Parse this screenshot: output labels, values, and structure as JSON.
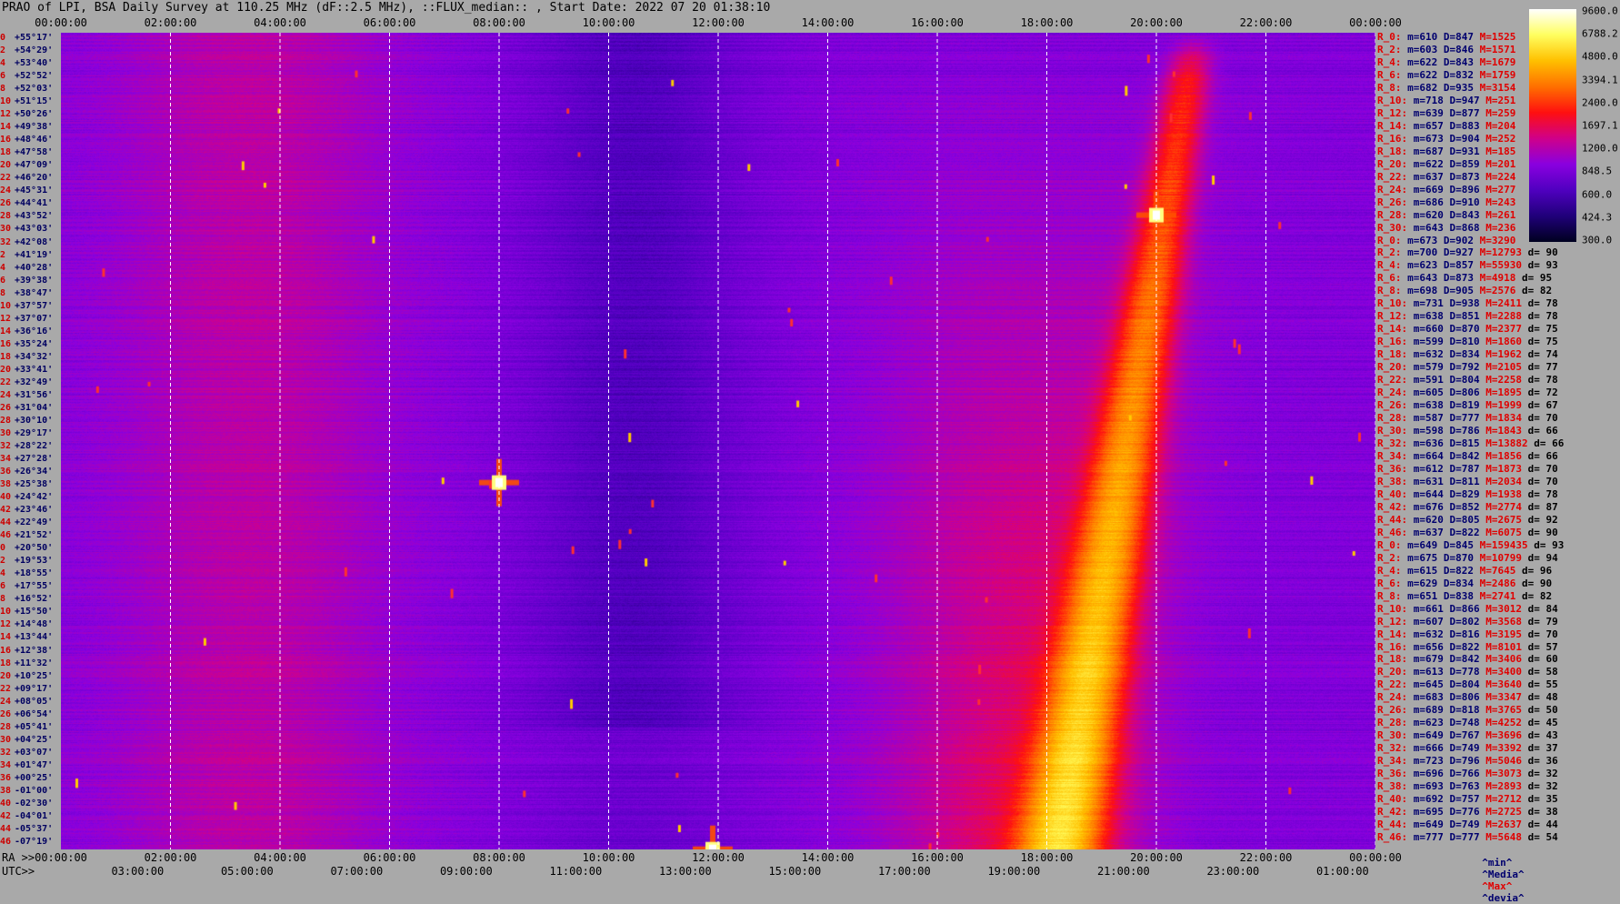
{
  "title": "PRAO of LPI, BSA Daily Survey at 110.25 MHz (dF::2.5 MHz), ::FLUX_median:: , Start Date: 2022 07 20 01:38:10",
  "top_axis": {
    "labels": [
      "00:00:00",
      "02:00:00",
      "04:00:00",
      "06:00:00",
      "08:00:00",
      "10:00:00",
      "12:00:00",
      "14:00:00",
      "16:00:00",
      "18:00:00",
      "20:00:00",
      "22:00:00",
      "00:00:00"
    ]
  },
  "bottom_axis": {
    "ra_prefix": "RA >>",
    "ra_labels": [
      "00:00:00",
      "02:00:00",
      "04:00:00",
      "06:00:00",
      "08:00:00",
      "10:00:00",
      "12:00:00",
      "14:00:00",
      "16:00:00",
      "18:00:00",
      "20:00:00",
      "22:00:00",
      "00:00:00"
    ],
    "utc_prefix": "UTC>>",
    "utc_labels": [
      "03:00:00",
      "05:00:00",
      "07:00:00",
      "09:00:00",
      "11:00:00",
      "13:00:00",
      "15:00:00",
      "17:00:00",
      "19:00:00",
      "21:00:00",
      "23:00:00",
      "01:00:00"
    ]
  },
  "colorbar": {
    "ticks": [
      "9600.0",
      "6788.2",
      "4800.0",
      "3394.1",
      "2400.0",
      "1697.1",
      "1200.0",
      "848.5",
      "600.0",
      "424.3",
      "300.0"
    ],
    "colors": [
      "#ffffff",
      "#ffff60",
      "#ffc000",
      "#ff7000",
      "#ff1010",
      "#d0008a",
      "#8a00e0",
      "#5000c0",
      "#20007a",
      "#000020"
    ]
  },
  "stats_footer": {
    "min": "^min^",
    "media": "^Media^",
    "max": "^Max^",
    "devia": "^devia^"
  },
  "declinations": [
    {
      "idx": "0",
      "dec": "+55°17'"
    },
    {
      "idx": "2",
      "dec": "+54°29'"
    },
    {
      "idx": "4",
      "dec": "+53°40'"
    },
    {
      "idx": "6",
      "dec": "+52°52'"
    },
    {
      "idx": "8",
      "dec": "+52°03'"
    },
    {
      "idx": "10",
      "dec": "+51°15'"
    },
    {
      "idx": "12",
      "dec": "+50°26'"
    },
    {
      "idx": "14",
      "dec": "+49°38'"
    },
    {
      "idx": "16",
      "dec": "+48°46'"
    },
    {
      "idx": "18",
      "dec": "+47°58'"
    },
    {
      "idx": "20",
      "dec": "+47°09'"
    },
    {
      "idx": "22",
      "dec": "+46°20'"
    },
    {
      "idx": "24",
      "dec": "+45°31'"
    },
    {
      "idx": "26",
      "dec": "+44°41'"
    },
    {
      "idx": "28",
      "dec": "+43°52'"
    },
    {
      "idx": "30",
      "dec": "+43°03'"
    },
    {
      "idx": "32",
      "dec": "+42°08'"
    },
    {
      "idx": "2",
      "dec": "+41°19'"
    },
    {
      "idx": "4",
      "dec": "+40°28'"
    },
    {
      "idx": "6",
      "dec": "+39°38'"
    },
    {
      "idx": "8",
      "dec": "+38°47'"
    },
    {
      "idx": "10",
      "dec": "+37°57'"
    },
    {
      "idx": "12",
      "dec": "+37°07'"
    },
    {
      "idx": "14",
      "dec": "+36°16'"
    },
    {
      "idx": "16",
      "dec": "+35°24'"
    },
    {
      "idx": "18",
      "dec": "+34°32'"
    },
    {
      "idx": "20",
      "dec": "+33°41'"
    },
    {
      "idx": "22",
      "dec": "+32°49'"
    },
    {
      "idx": "24",
      "dec": "+31°56'"
    },
    {
      "idx": "26",
      "dec": "+31°04'"
    },
    {
      "idx": "28",
      "dec": "+30°10'"
    },
    {
      "idx": "30",
      "dec": "+29°17'"
    },
    {
      "idx": "32",
      "dec": "+28°22'"
    },
    {
      "idx": "34",
      "dec": "+27°28'"
    },
    {
      "idx": "36",
      "dec": "+26°34'"
    },
    {
      "idx": "38",
      "dec": "+25°38'"
    },
    {
      "idx": "40",
      "dec": "+24°42'"
    },
    {
      "idx": "42",
      "dec": "+23°46'"
    },
    {
      "idx": "44",
      "dec": "+22°49'"
    },
    {
      "idx": "46",
      "dec": "+21°52'"
    },
    {
      "idx": "0",
      "dec": "+20°50'"
    },
    {
      "idx": "2",
      "dec": "+19°53'"
    },
    {
      "idx": "4",
      "dec": "+18°55'"
    },
    {
      "idx": "6",
      "dec": "+17°55'"
    },
    {
      "idx": "8",
      "dec": "+16°52'"
    },
    {
      "idx": "10",
      "dec": "+15°50'"
    },
    {
      "idx": "12",
      "dec": "+14°48'"
    },
    {
      "idx": "14",
      "dec": "+13°44'"
    },
    {
      "idx": "16",
      "dec": "+12°38'"
    },
    {
      "idx": "18",
      "dec": "+11°32'"
    },
    {
      "idx": "20",
      "dec": "+10°25'"
    },
    {
      "idx": "22",
      "dec": "+09°17'"
    },
    {
      "idx": "24",
      "dec": "+08°05'"
    },
    {
      "idx": "26",
      "dec": "+06°54'"
    },
    {
      "idx": "28",
      "dec": "+05°41'"
    },
    {
      "idx": "30",
      "dec": "+04°25'"
    },
    {
      "idx": "32",
      "dec": "+03°07'"
    },
    {
      "idx": "34",
      "dec": "+01°47'"
    },
    {
      "idx": "36",
      "dec": "+00°25'"
    },
    {
      "idx": "38",
      "dec": "-01°00'"
    },
    {
      "idx": "40",
      "dec": "-02°30'"
    },
    {
      "idx": "42",
      "dec": "-04°01'"
    },
    {
      "idx": "44",
      "dec": "-05°37'"
    },
    {
      "idx": "46",
      "dec": "-07°19'"
    }
  ],
  "stats": [
    {
      "r": "R_0:",
      "m": "m=610",
      "d": "D=847",
      "x": "M=1525",
      "dv": ""
    },
    {
      "r": "R_2:",
      "m": "m=603",
      "d": "D=846",
      "x": "M=1571",
      "dv": ""
    },
    {
      "r": "R_4:",
      "m": "m=622",
      "d": "D=843",
      "x": "M=1679",
      "dv": ""
    },
    {
      "r": "R_6:",
      "m": "m=622",
      "d": "D=832",
      "x": "M=1759",
      "dv": ""
    },
    {
      "r": "R_8:",
      "m": "m=682",
      "d": "D=935",
      "x": "M=3154",
      "dv": ""
    },
    {
      "r": "R_10:",
      "m": "m=718",
      "d": "D=947",
      "x": "M=251",
      "dv": ""
    },
    {
      "r": "R_12:",
      "m": "m=639",
      "d": "D=877",
      "x": "M=259",
      "dv": ""
    },
    {
      "r": "R_14:",
      "m": "m=657",
      "d": "D=883",
      "x": "M=204",
      "dv": ""
    },
    {
      "r": "R_16:",
      "m": "m=673",
      "d": "D=904",
      "x": "M=252",
      "dv": ""
    },
    {
      "r": "R_18:",
      "m": "m=687",
      "d": "D=931",
      "x": "M=185",
      "dv": ""
    },
    {
      "r": "R_20:",
      "m": "m=622",
      "d": "D=859",
      "x": "M=201",
      "dv": ""
    },
    {
      "r": "R_22:",
      "m": "m=637",
      "d": "D=873",
      "x": "M=224",
      "dv": ""
    },
    {
      "r": "R_24:",
      "m": "m=669",
      "d": "D=896",
      "x": "M=277",
      "dv": ""
    },
    {
      "r": "R_26:",
      "m": "m=686",
      "d": "D=910",
      "x": "M=243",
      "dv": ""
    },
    {
      "r": "R_28:",
      "m": "m=620",
      "d": "D=843",
      "x": "M=261",
      "dv": ""
    },
    {
      "r": "R_30:",
      "m": "m=643",
      "d": "D=868",
      "x": "M=236",
      "dv": ""
    },
    {
      "r": "R_0:",
      "m": "m=673",
      "d": "D=902",
      "x": "M=3290",
      "dv": ""
    },
    {
      "r": "R_2:",
      "m": "m=700",
      "d": "D=927",
      "x": "M=12793",
      "dv": "d= 90"
    },
    {
      "r": "R_4:",
      "m": "m=623",
      "d": "D=857",
      "x": "M=55930",
      "dv": "d= 93"
    },
    {
      "r": "R_6:",
      "m": "m=643",
      "d": "D=873",
      "x": "M=4918",
      "dv": "d= 95"
    },
    {
      "r": "R_8:",
      "m": "m=698",
      "d": "D=905",
      "x": "M=2576",
      "dv": "d= 82"
    },
    {
      "r": "R_10:",
      "m": "m=731",
      "d": "D=938",
      "x": "M=2411",
      "dv": "d= 78"
    },
    {
      "r": "R_12:",
      "m": "m=638",
      "d": "D=851",
      "x": "M=2288",
      "dv": "d= 78"
    },
    {
      "r": "R_14:",
      "m": "m=660",
      "d": "D=870",
      "x": "M=2377",
      "dv": "d= 75"
    },
    {
      "r": "R_16:",
      "m": "m=599",
      "d": "D=810",
      "x": "M=1860",
      "dv": "d= 75"
    },
    {
      "r": "R_18:",
      "m": "m=632",
      "d": "D=834",
      "x": "M=1962",
      "dv": "d= 74"
    },
    {
      "r": "R_20:",
      "m": "m=579",
      "d": "D=792",
      "x": "M=2105",
      "dv": "d= 77"
    },
    {
      "r": "R_22:",
      "m": "m=591",
      "d": "D=804",
      "x": "M=2258",
      "dv": "d= 78"
    },
    {
      "r": "R_24:",
      "m": "m=605",
      "d": "D=806",
      "x": "M=1895",
      "dv": "d= 72"
    },
    {
      "r": "R_26:",
      "m": "m=638",
      "d": "D=819",
      "x": "M=1999",
      "dv": "d= 67"
    },
    {
      "r": "R_28:",
      "m": "m=587",
      "d": "D=777",
      "x": "M=1834",
      "dv": "d= 70"
    },
    {
      "r": "R_30:",
      "m": "m=598",
      "d": "D=786",
      "x": "M=1843",
      "dv": "d= 66"
    },
    {
      "r": "R_32:",
      "m": "m=636",
      "d": "D=815",
      "x": "M=13882",
      "dv": "d= 66"
    },
    {
      "r": "R_34:",
      "m": "m=664",
      "d": "D=842",
      "x": "M=1856",
      "dv": "d= 66"
    },
    {
      "r": "R_36:",
      "m": "m=612",
      "d": "D=787",
      "x": "M=1873",
      "dv": "d= 70"
    },
    {
      "r": "R_38:",
      "m": "m=631",
      "d": "D=811",
      "x": "M=2034",
      "dv": "d= 70"
    },
    {
      "r": "R_40:",
      "m": "m=644",
      "d": "D=829",
      "x": "M=1938",
      "dv": "d= 78"
    },
    {
      "r": "R_42:",
      "m": "m=676",
      "d": "D=852",
      "x": "M=2774",
      "dv": "d= 87"
    },
    {
      "r": "R_44:",
      "m": "m=620",
      "d": "D=805",
      "x": "M=2675",
      "dv": "d= 92"
    },
    {
      "r": "R_46:",
      "m": "m=637",
      "d": "D=822",
      "x": "M=6075",
      "dv": "d= 90"
    },
    {
      "r": "R_0:",
      "m": "m=649",
      "d": "D=845",
      "x": "M=159435",
      "dv": "d= 93"
    },
    {
      "r": "R_2:",
      "m": "m=675",
      "d": "D=870",
      "x": "M=10799",
      "dv": "d= 94"
    },
    {
      "r": "R_4:",
      "m": "m=615",
      "d": "D=822",
      "x": "M=7645",
      "dv": "d= 96"
    },
    {
      "r": "R_6:",
      "m": "m=629",
      "d": "D=834",
      "x": "M=2486",
      "dv": "d= 90"
    },
    {
      "r": "R_8:",
      "m": "m=651",
      "d": "D=838",
      "x": "M=2741",
      "dv": "d= 82"
    },
    {
      "r": "R_10:",
      "m": "m=661",
      "d": "D=866",
      "x": "M=3012",
      "dv": "d= 84"
    },
    {
      "r": "R_12:",
      "m": "m=607",
      "d": "D=802",
      "x": "M=3568",
      "dv": "d= 79"
    },
    {
      "r": "R_14:",
      "m": "m=632",
      "d": "D=816",
      "x": "M=3195",
      "dv": "d= 70"
    },
    {
      "r": "R_16:",
      "m": "m=656",
      "d": "D=822",
      "x": "M=8101",
      "dv": "d= 57"
    },
    {
      "r": "R_18:",
      "m": "m=679",
      "d": "D=842",
      "x": "M=3406",
      "dv": "d= 60"
    },
    {
      "r": "R_20:",
      "m": "m=613",
      "d": "D=778",
      "x": "M=3400",
      "dv": "d= 58"
    },
    {
      "r": "R_22:",
      "m": "m=645",
      "d": "D=804",
      "x": "M=3640",
      "dv": "d= 55"
    },
    {
      "r": "R_24:",
      "m": "m=683",
      "d": "D=806",
      "x": "M=3347",
      "dv": "d= 48"
    },
    {
      "r": "R_26:",
      "m": "m=689",
      "d": "D=818",
      "x": "M=3765",
      "dv": "d= 50"
    },
    {
      "r": "R_28:",
      "m": "m=623",
      "d": "D=748",
      "x": "M=4252",
      "dv": "d= 45"
    },
    {
      "r": "R_30:",
      "m": "m=649",
      "d": "D=767",
      "x": "M=3696",
      "dv": "d= 43"
    },
    {
      "r": "R_32:",
      "m": "m=666",
      "d": "D=749",
      "x": "M=3392",
      "dv": "d= 37"
    },
    {
      "r": "R_34:",
      "m": "m=723",
      "d": "D=796",
      "x": "M=5046",
      "dv": "d= 36"
    },
    {
      "r": "R_36:",
      "m": "m=696",
      "d": "D=766",
      "x": "M=3073",
      "dv": "d= 32"
    },
    {
      "r": "R_38:",
      "m": "m=693",
      "d": "D=763",
      "x": "M=2893",
      "dv": "d= 32"
    },
    {
      "r": "R_40:",
      "m": "m=692",
      "d": "D=757",
      "x": "M=2712",
      "dv": "d= 35"
    },
    {
      "r": "R_42:",
      "m": "m=695",
      "d": "D=776",
      "x": "M=2725",
      "dv": "d= 38"
    },
    {
      "r": "R_44:",
      "m": "m=649",
      "d": "D=749",
      "x": "M=2637",
      "dv": "d= 44"
    },
    {
      "r": "R_46:",
      "m": "m=777",
      "d": "D=777",
      "x": "M=5648",
      "dv": "d= 54"
    }
  ],
  "chart_data": {
    "type": "heatmap",
    "title": "PRAO of LPI, BSA Daily Survey at 110.25 MHz (dF::2.5 MHz), ::FLUX_median:: , Start Date: 2022 07 20 01:38:10",
    "x_axis": "RA / UTC time over 24 h",
    "y_axis": "Declination, +55°17' to -07°19'",
    "color_scale": "log",
    "vmin": 300.0,
    "vmax": 9600.0,
    "features": [
      {
        "name": "milky-way-band",
        "ra_start_h": 18.0,
        "ra_end_h": 20.8,
        "dec_start": -7.3,
        "dec_end": 52.0,
        "peak_flux": 5000
      },
      {
        "name": "bright-source-1",
        "ra_h": 8.0,
        "dec": 20.8,
        "peak_flux": 9600
      },
      {
        "name": "bright-source-2",
        "ra_h": 20.0,
        "dec": 41.3,
        "peak_flux": 9600
      },
      {
        "name": "bright-source-3",
        "ra_h": 11.9,
        "dec": -7.3,
        "peak_flux": 9600
      }
    ]
  }
}
